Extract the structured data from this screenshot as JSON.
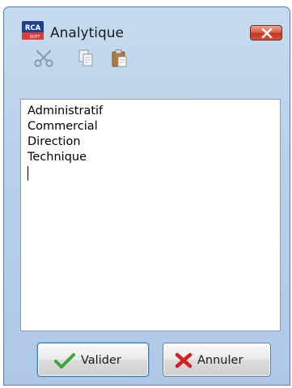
{
  "window": {
    "logo_text_top": "RCA",
    "logo_text_bottom": "SOFT",
    "title": "Analytique"
  },
  "toolbar": {
    "items": [
      "scissors-icon",
      "copy-icon",
      "paste-icon"
    ]
  },
  "editor": {
    "lines": [
      "Administratif",
      "Commercial",
      "Direction",
      "Technique"
    ]
  },
  "buttons": {
    "validate_label": "Valider",
    "cancel_label": "Annuler"
  },
  "colors": {
    "window_bg": "#b9d1ea",
    "close_button": "#c2351f",
    "validate_check": "#3aa83a",
    "cancel_cross": "#d42020"
  }
}
